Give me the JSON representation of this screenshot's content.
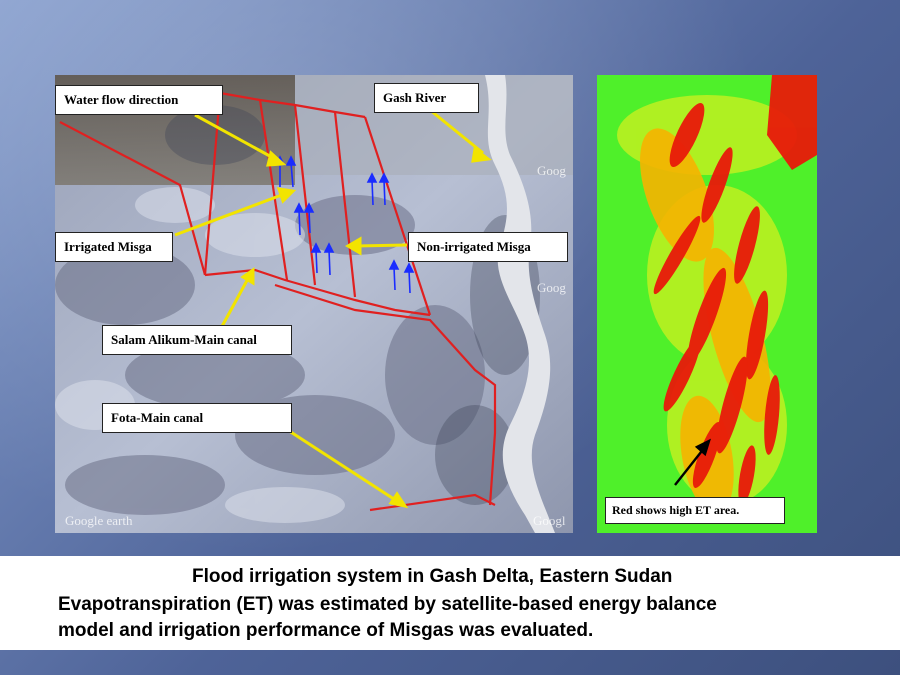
{
  "labels": {
    "water_flow": "Water flow direction",
    "gash_river": "Gash River",
    "irrigated": "Irrigated Misga",
    "non_irrigated": "Non-irrigated Misga",
    "salam_canal": "Salam Alikum-Main canal",
    "fota_canal": "Fota-Main canal",
    "red_et": "Red shows high ET area."
  },
  "watermarks": {
    "ge_left": "Google earth",
    "ge_right": "Googl",
    "ge_mid1": "Goog",
    "ge_mid2": "Goog"
  },
  "caption": {
    "line1": "Flood irrigation system in Gash Delta, Eastern Sudan",
    "line2": "Evapotranspiration (ET) was estimated by satellite-based energy balance",
    "line3": "model and irrigation performance of Misgas was evaluated."
  },
  "colors": {
    "canal": "#e02020",
    "arrow_pointer": "#f2e400",
    "flow_arrow": "#1a2cff",
    "et_high": "#e81a0a",
    "et_low": "#4ff02a"
  }
}
